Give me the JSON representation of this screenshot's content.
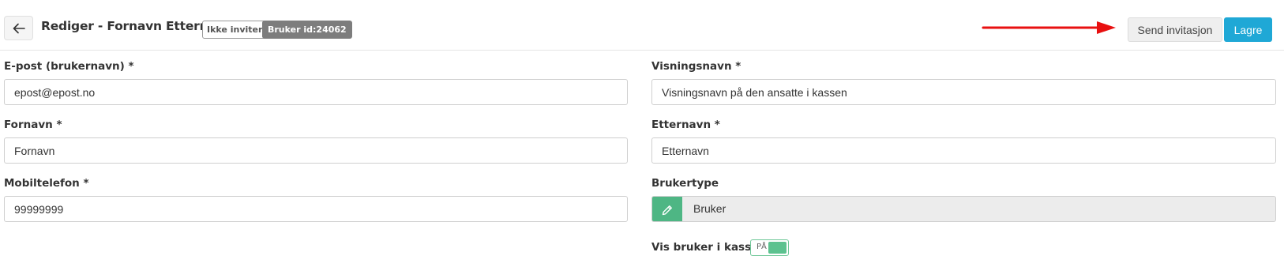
{
  "header": {
    "title": "Rediger - Fornavn Etternavn",
    "status_badge": "Ikke invitert",
    "user_id_badge": "Bruker id:24062",
    "send_invitation_label": "Send invitasjon",
    "save_label": "Lagre",
    "arrow_color": "#e81010",
    "save_color": "#1fa8d6"
  },
  "form": {
    "email": {
      "label": "E-post (brukernavn) *",
      "value": "epost@epost.no"
    },
    "first_name": {
      "label": "Fornavn *",
      "value": "Fornavn"
    },
    "mobile": {
      "label": "Mobiltelefon *",
      "value": "99999999"
    },
    "display_name": {
      "label": "Visningsnavn *",
      "value": "Visningsnavn på den ansatte i kassen"
    },
    "last_name": {
      "label": "Etternavn *",
      "value": "Etternavn"
    },
    "user_type": {
      "label": "Brukertype",
      "value": "Bruker",
      "edit_icon": "pencil-icon"
    },
    "show_in_register": {
      "label": "Vis bruker i kassen",
      "toggle_text": "PÅ",
      "on": true
    }
  }
}
